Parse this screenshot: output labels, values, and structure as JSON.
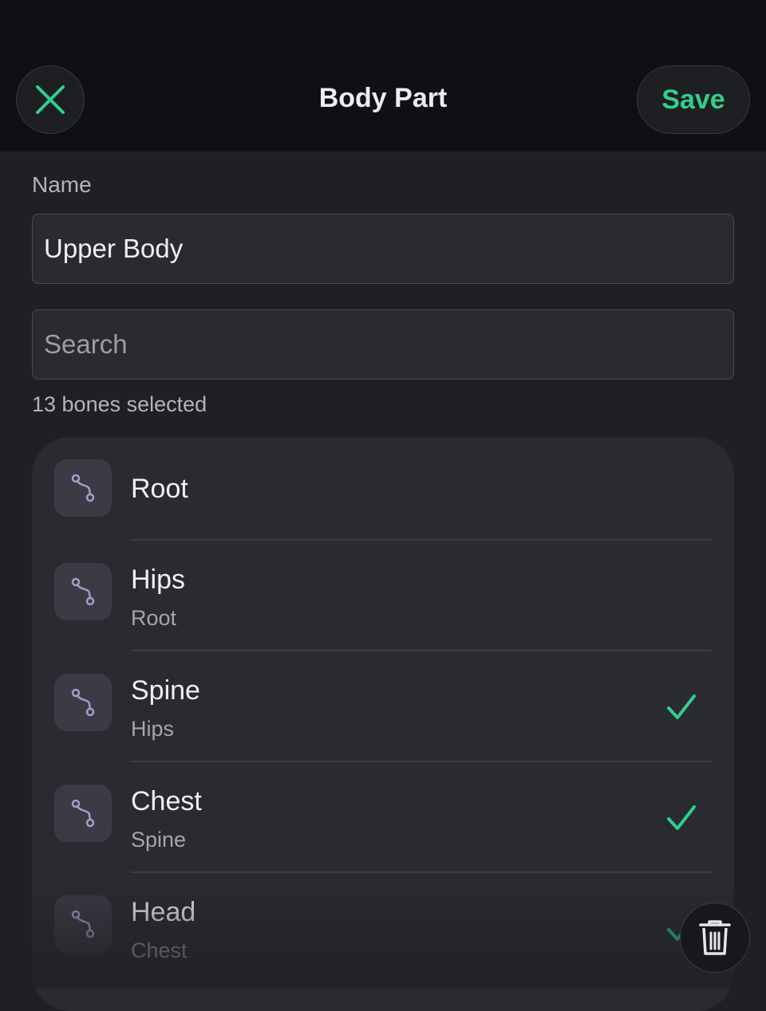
{
  "header": {
    "title": "Body Part",
    "save_label": "Save",
    "close_icon": "close-icon"
  },
  "form": {
    "name_label": "Name",
    "name_value": "Upper Body",
    "search_placeholder": "Search"
  },
  "selection_count": "13 bones selected",
  "bones": [
    {
      "name": "Root",
      "parent": "",
      "selected": false,
      "icon": "bone-icon"
    },
    {
      "name": "Hips",
      "parent": "Root",
      "selected": false,
      "icon": "bone-icon"
    },
    {
      "name": "Spine",
      "parent": "Hips",
      "selected": true,
      "icon": "bone-icon"
    },
    {
      "name": "Chest",
      "parent": "Spine",
      "selected": true,
      "icon": "bone-icon"
    },
    {
      "name": "Head",
      "parent": "Chest",
      "selected": true,
      "icon": "bone-icon"
    }
  ],
  "actions": {
    "delete_icon": "trash-icon"
  },
  "colors": {
    "accent": "#2fd08c",
    "background": "#1f2024",
    "header": "#0f1013",
    "icon": "#a99bc9"
  }
}
